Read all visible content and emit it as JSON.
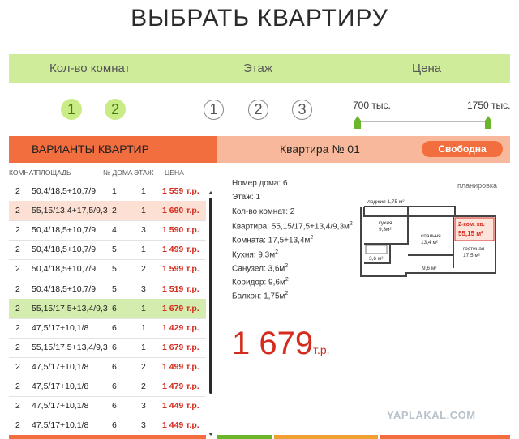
{
  "page": {
    "title": "ВЫБРАТЬ КВАРТИРУ"
  },
  "filters": {
    "rooms_label": "Кол-во комнат",
    "floor_label": "Этаж",
    "price_label": "Цена",
    "rooms": [
      {
        "value": "1",
        "selected": true
      },
      {
        "value": "2",
        "selected": true
      }
    ],
    "floors": [
      {
        "value": "1"
      },
      {
        "value": "2"
      },
      {
        "value": "3"
      }
    ],
    "price_min": "700 тыс.",
    "price_max": "1750 тыс."
  },
  "variants": {
    "header": "ВАРИАНТЫ КВАРТИР",
    "columns": {
      "rooms": "КОМНАТ",
      "area": "ПЛОЩАДЬ",
      "house": "№ ДОМА",
      "floor": "ЭТАЖ",
      "price": "ЦЕНА"
    },
    "rows": [
      {
        "rooms": "2",
        "area": "50,4/18,5+10,7/9",
        "house": "1",
        "floor": "1",
        "price": "1 559 т.р."
      },
      {
        "rooms": "2",
        "area": "55,15/13,4+17,5/9,3",
        "house": "2",
        "floor": "1",
        "price": "1 690 т.р."
      },
      {
        "rooms": "2",
        "area": "50,4/18,5+10,7/9",
        "house": "4",
        "floor": "3",
        "price": "1 590 т.р."
      },
      {
        "rooms": "2",
        "area": "50,4/18,5+10,7/9",
        "house": "5",
        "floor": "1",
        "price": "1 499 т.р."
      },
      {
        "rooms": "2",
        "area": "50,4/18,5+10,7/9",
        "house": "5",
        "floor": "2",
        "price": "1 599 т.р."
      },
      {
        "rooms": "2",
        "area": "50,4/18,5+10,7/9",
        "house": "5",
        "floor": "3",
        "price": "1 519 т.р."
      },
      {
        "rooms": "2",
        "area": "55,15/17,5+13,4/9,3",
        "house": "6",
        "floor": "1",
        "price": "1 679 т.р."
      },
      {
        "rooms": "2",
        "area": "47,5/17+10,1/8",
        "house": "6",
        "floor": "1",
        "price": "1 429 т.р."
      },
      {
        "rooms": "2",
        "area": "55,15/17,5+13,4/9,3",
        "house": "6",
        "floor": "1",
        "price": "1 679 т.р."
      },
      {
        "rooms": "2",
        "area": "47,5/17+10,1/8",
        "house": "6",
        "floor": "2",
        "price": "1 499 т.р."
      },
      {
        "rooms": "2",
        "area": "47,5/17+10,1/8",
        "house": "6",
        "floor": "2",
        "price": "1 479 т.р."
      },
      {
        "rooms": "2",
        "area": "47,5/17+10,1/8",
        "house": "6",
        "floor": "3",
        "price": "1 449 т.р."
      },
      {
        "rooms": "2",
        "area": "47,5/17+10,1/8",
        "house": "6",
        "floor": "3",
        "price": "1 449 т.р."
      }
    ],
    "highlighted_row": 6,
    "alt_row": 1
  },
  "apartment": {
    "name": "Квартира № 01",
    "status": "Свободна",
    "details": [
      {
        "text": "Номер дома: 6",
        "sup": ""
      },
      {
        "text": "Этаж: 1",
        "sup": ""
      },
      {
        "text": "Кол-во комнат: 2",
        "sup": ""
      },
      {
        "text": "Квартира: 55,15/17,5+13,4/9,3м",
        "sup": "2"
      },
      {
        "text": "Комната: 17,5+13,4м",
        "sup": "2"
      },
      {
        "text": "Кухня: 9,3м",
        "sup": "2"
      },
      {
        "text": "Санузел: 3,6м",
        "sup": "2"
      },
      {
        "text": "Коридор: 9,6м",
        "sup": "2"
      },
      {
        "text": "Балкон: 1,75м",
        "sup": "2"
      }
    ],
    "price_value": "1 679",
    "price_unit": "т.р.",
    "plan_label": "планировка",
    "plan": {
      "loggia": "лоджия 1,75 м²",
      "kitchen_name": "кухня",
      "kitchen_area": "9,3м²",
      "bedroom_name": "спальня",
      "bedroom_area": "13,4 м²",
      "bath_area": "3,6 м²",
      "corridor_area": "9,6 м²",
      "badge_title": "2-ком. кв.",
      "badge_area": "55,15 м²",
      "living_name": "гостиная",
      "living_area": "17,5 м²"
    }
  },
  "watermark": "YAPLAKAL.COM",
  "colors": {
    "accent_orange": "#f36e3f",
    "accent_green": "#cfec9b",
    "price_red": "#d52b1e",
    "slider_green": "#6bb52a"
  }
}
